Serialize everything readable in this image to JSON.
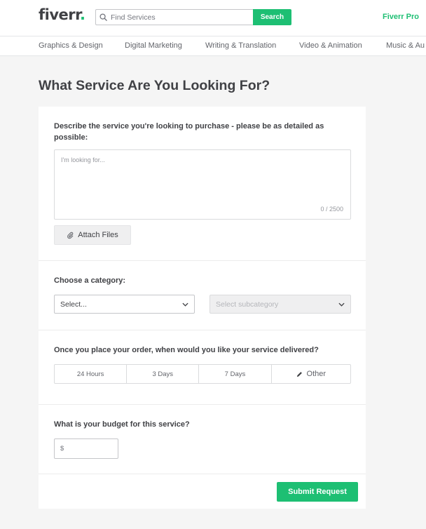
{
  "header": {
    "logo_text": "fiverr",
    "logo_dot": ".",
    "search_placeholder": "Find Services",
    "search_button": "Search",
    "pro_link": "Fiverr Pro"
  },
  "nav": {
    "categories": [
      "Graphics & Design",
      "Digital Marketing",
      "Writing & Translation",
      "Video & Animation",
      "Music & Au"
    ]
  },
  "page": {
    "title": "What Service Are You Looking For?"
  },
  "form": {
    "describe_label": "Describe the service you're looking to purchase - please be as detailed as possible:",
    "describe_placeholder": "I'm looking for...",
    "char_count": "0 / 2500",
    "attach_label": "Attach Files",
    "category_label": "Choose a category:",
    "category_select": "Select...",
    "subcategory_select": "Select subcategory",
    "delivery_label": "Once you place your order, when would you like your service delivered?",
    "delivery_options": [
      "24 Hours",
      "3 Days",
      "7 Days",
      "Other"
    ],
    "budget_label": "What is your budget for this service?",
    "budget_currency": "$",
    "submit_label": "Submit Request"
  },
  "colors": {
    "brand_green": "#1dbf73",
    "text_dark": "#404145"
  },
  "icons": {
    "search": "search-icon",
    "attach": "paperclip-icon",
    "chevron": "chevron-down-icon",
    "pencil": "pencil-icon"
  }
}
